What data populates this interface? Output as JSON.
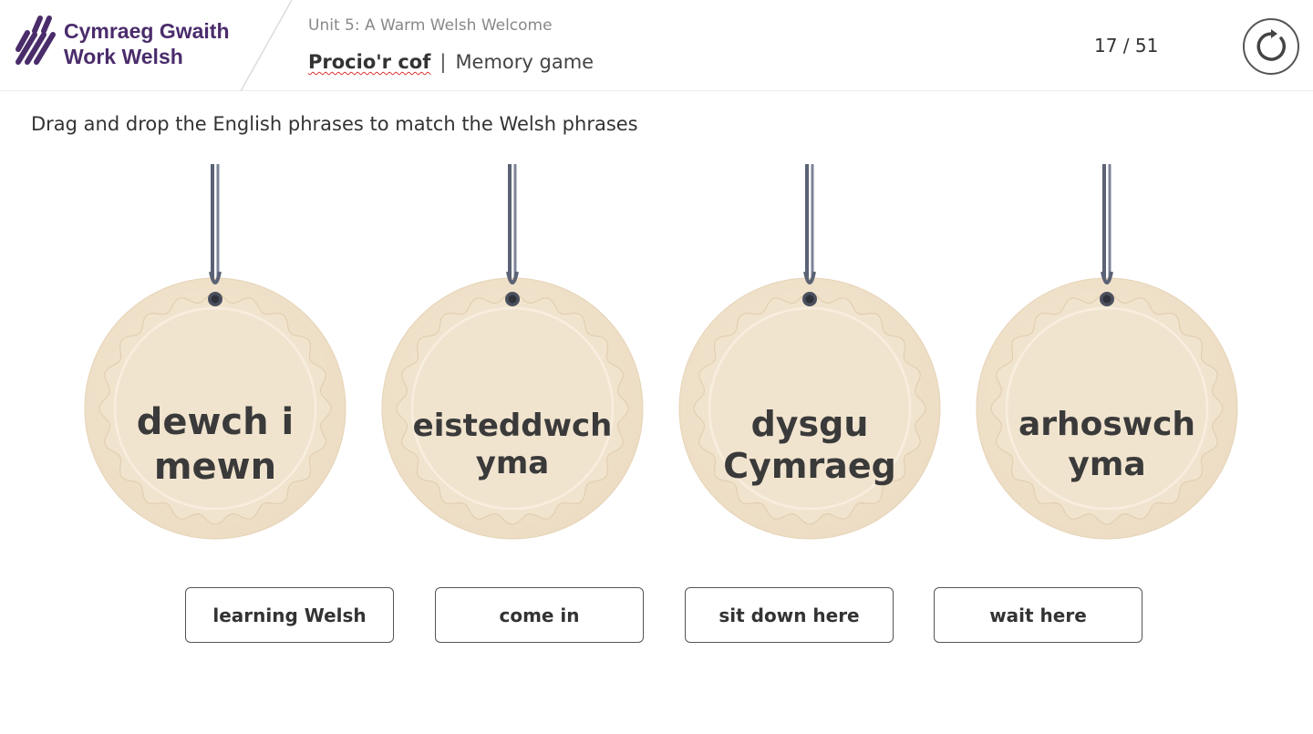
{
  "header": {
    "logo": {
      "line1": "Cymraeg Gwaith",
      "line2": "Work Welsh"
    },
    "unit_title": "Unit 5:  A Warm Welsh Welcome",
    "lesson_welsh": "Procio'r cof",
    "lesson_separator": "|",
    "lesson_english": "Memory game",
    "progress": "17 / 51",
    "restart_icon": "restart-icon"
  },
  "instruction": "Drag and drop the English phrases to match the Welsh phrases",
  "tags": [
    {
      "line1": "dewch i",
      "line2": "mewn"
    },
    {
      "line1": "eisteddwch",
      "line2": "yma"
    },
    {
      "line1": "dysgu",
      "line2": "Cymraeg"
    },
    {
      "line1": "arhoswch",
      "line2": "yma"
    }
  ],
  "answers": [
    "learning Welsh",
    "come in",
    "sit down here",
    "wait here"
  ],
  "colors": {
    "brand": "#4a2c6b",
    "tag_fill": "#ecdcc3",
    "tag_inner": "#f1e4cf",
    "string": "#5b6275"
  }
}
